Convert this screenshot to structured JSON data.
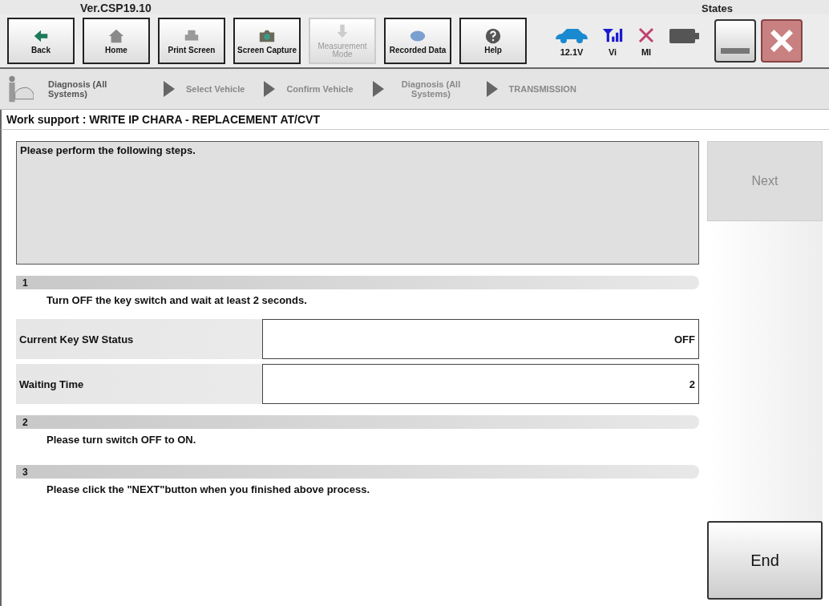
{
  "header": {
    "version": "Ver.CSP19.10",
    "states_label": "States"
  },
  "toolbar": [
    {
      "kind": "back",
      "label": "Back",
      "disabled": false
    },
    {
      "kind": "home",
      "label": "Home",
      "disabled": false
    },
    {
      "kind": "print",
      "label": "Print Screen",
      "disabled": false
    },
    {
      "kind": "camera",
      "label": "Screen Capture",
      "disabled": false
    },
    {
      "kind": "measure",
      "label": "Measurement Mode",
      "disabled": true
    },
    {
      "kind": "recorded",
      "label": "Recorded Data",
      "disabled": false
    },
    {
      "kind": "help",
      "label": "Help",
      "disabled": false
    }
  ],
  "status_indicators": [
    {
      "kind": "car",
      "label": "12.1V"
    },
    {
      "kind": "signal",
      "label": "Vi"
    },
    {
      "kind": "cross",
      "label": "MI"
    },
    {
      "kind": "battery"
    }
  ],
  "breadcrumb": [
    "Diagnosis (All Systems)",
    "Select Vehicle",
    "Confirm Vehicle",
    "Diagnosis (All Systems)",
    "TRANSMISSION"
  ],
  "page_title": "Work support : WRITE IP CHARA - REPLACEMENT AT/CVT",
  "message": "Please perform the following steps.",
  "steps": [
    {
      "number": "1",
      "instruction": "Turn OFF the key switch and wait at least 2 seconds.",
      "fields": [
        {
          "label": "Current Key SW Status",
          "value": "OFF"
        },
        {
          "label": "Waiting Time",
          "value": "2"
        }
      ]
    },
    {
      "number": "2",
      "instruction": "Please turn switch OFF to ON."
    },
    {
      "number": "3",
      "instruction": "Please click the \"NEXT\"button when you finished above process."
    }
  ],
  "next_button": {
    "label": "Next",
    "disabled": true
  },
  "end_button": {
    "label": "End",
    "disabled": false
  }
}
